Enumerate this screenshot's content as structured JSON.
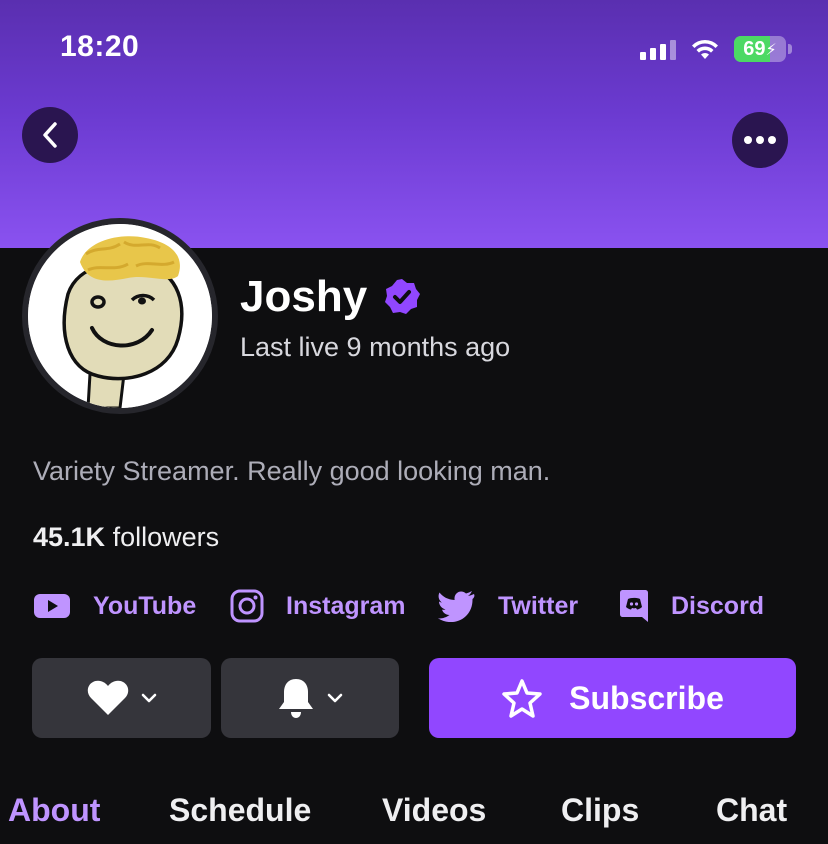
{
  "status_bar": {
    "time": "18:20",
    "battery_level": 69,
    "battery_text": "69",
    "icons": [
      "signal-icon",
      "wifi-icon",
      "battery-charging-icon"
    ]
  },
  "header": {
    "back_icon": "chevron-left-icon",
    "more_icon": "more-dots-icon"
  },
  "profile": {
    "name": "Joshy",
    "verified": true,
    "last_live": "Last live 9 months ago",
    "bio": "Variety Streamer. Really good looking man.",
    "followers_count": "45.1K",
    "followers_label": "followers"
  },
  "socials": [
    {
      "label": "YouTube",
      "icon": "youtube-icon"
    },
    {
      "label": "Instagram",
      "icon": "instagram-icon"
    },
    {
      "label": "Twitter",
      "icon": "twitter-icon"
    },
    {
      "label": "Discord",
      "icon": "discord-icon"
    }
  ],
  "actions": {
    "follow_icon": "heart-icon",
    "notify_icon": "bell-icon",
    "subscribe_label": "Subscribe",
    "subscribe_icon": "star-icon"
  },
  "tabs": [
    {
      "label": "About",
      "active": true
    },
    {
      "label": "Schedule",
      "active": false
    },
    {
      "label": "Videos",
      "active": false
    },
    {
      "label": "Clips",
      "active": false
    },
    {
      "label": "Chat",
      "active": false
    }
  ],
  "colors": {
    "accent": "#9147ff",
    "accent_text": "#bf94ff",
    "banner_top": "#5a2fb0",
    "banner_bottom": "#8a52f0",
    "background": "#0e0e10",
    "button_gray": "#35353b"
  }
}
